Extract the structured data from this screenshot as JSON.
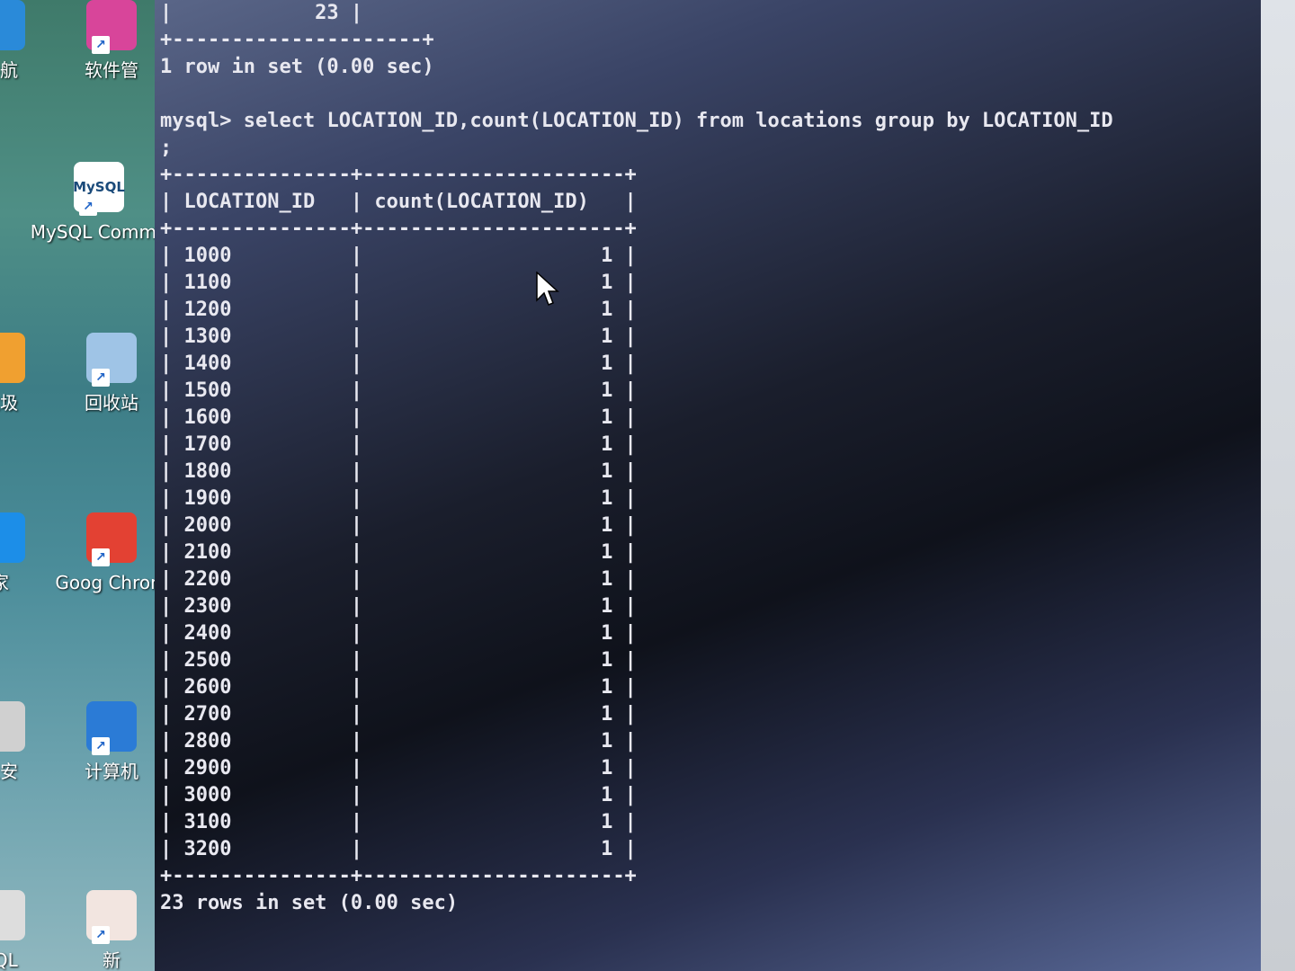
{
  "desktop": {
    "icons": [
      {
        "label": "导航",
        "icon": "ie-icon",
        "color": "#2a8ad9"
      },
      {
        "label": "软件管",
        "icon": "software-manager-icon",
        "color": "#d8459a"
      },
      {
        "label": "MySQL Comma",
        "icon": "mysql-icon",
        "color": "#ffffff",
        "badge": "MySQL"
      },
      {
        "label": "垃圾",
        "icon": "cleanup-icon",
        "color": "#f0a030"
      },
      {
        "label": "回收站",
        "icon": "recycle-bin-icon",
        "color": "#9fc4e6"
      },
      {
        "label": "家",
        "icon": "security-home-icon",
        "color": "#1c8ee8"
      },
      {
        "label": "Goog Chrom",
        "icon": "chrome-icon",
        "color": "#e34133"
      },
      {
        "label": "卫安",
        "icon": "shield-icon",
        "color": "#d0d0d0"
      },
      {
        "label": "计算机",
        "icon": "computer-icon",
        "color": "#2b7bd6"
      },
      {
        "label": "SQL",
        "icon": "sql-icon",
        "color": "#dddddd"
      },
      {
        "label": "新",
        "icon": "document-icon",
        "color": "#f2e5e0"
      }
    ]
  },
  "console": {
    "prev_tail_value": "23",
    "prev_rowcount": "1 row in set (0.00 sec)",
    "prompt": "mysql>",
    "query": "select LOCATION_ID,count(LOCATION_ID) from locations group by LOCATION_ID",
    "query_continuation": ";",
    "columns": [
      "LOCATION_ID",
      "count(LOCATION_ID)"
    ],
    "rows": [
      [
        "1000",
        "1"
      ],
      [
        "1100",
        "1"
      ],
      [
        "1200",
        "1"
      ],
      [
        "1300",
        "1"
      ],
      [
        "1400",
        "1"
      ],
      [
        "1500",
        "1"
      ],
      [
        "1600",
        "1"
      ],
      [
        "1700",
        "1"
      ],
      [
        "1800",
        "1"
      ],
      [
        "1900",
        "1"
      ],
      [
        "2000",
        "1"
      ],
      [
        "2100",
        "1"
      ],
      [
        "2200",
        "1"
      ],
      [
        "2300",
        "1"
      ],
      [
        "2400",
        "1"
      ],
      [
        "2500",
        "1"
      ],
      [
        "2600",
        "1"
      ],
      [
        "2700",
        "1"
      ],
      [
        "2800",
        "1"
      ],
      [
        "2900",
        "1"
      ],
      [
        "3000",
        "1"
      ],
      [
        "3100",
        "1"
      ],
      [
        "3200",
        "1"
      ]
    ],
    "result_summary": "23 rows in set (0.00 sec)"
  }
}
